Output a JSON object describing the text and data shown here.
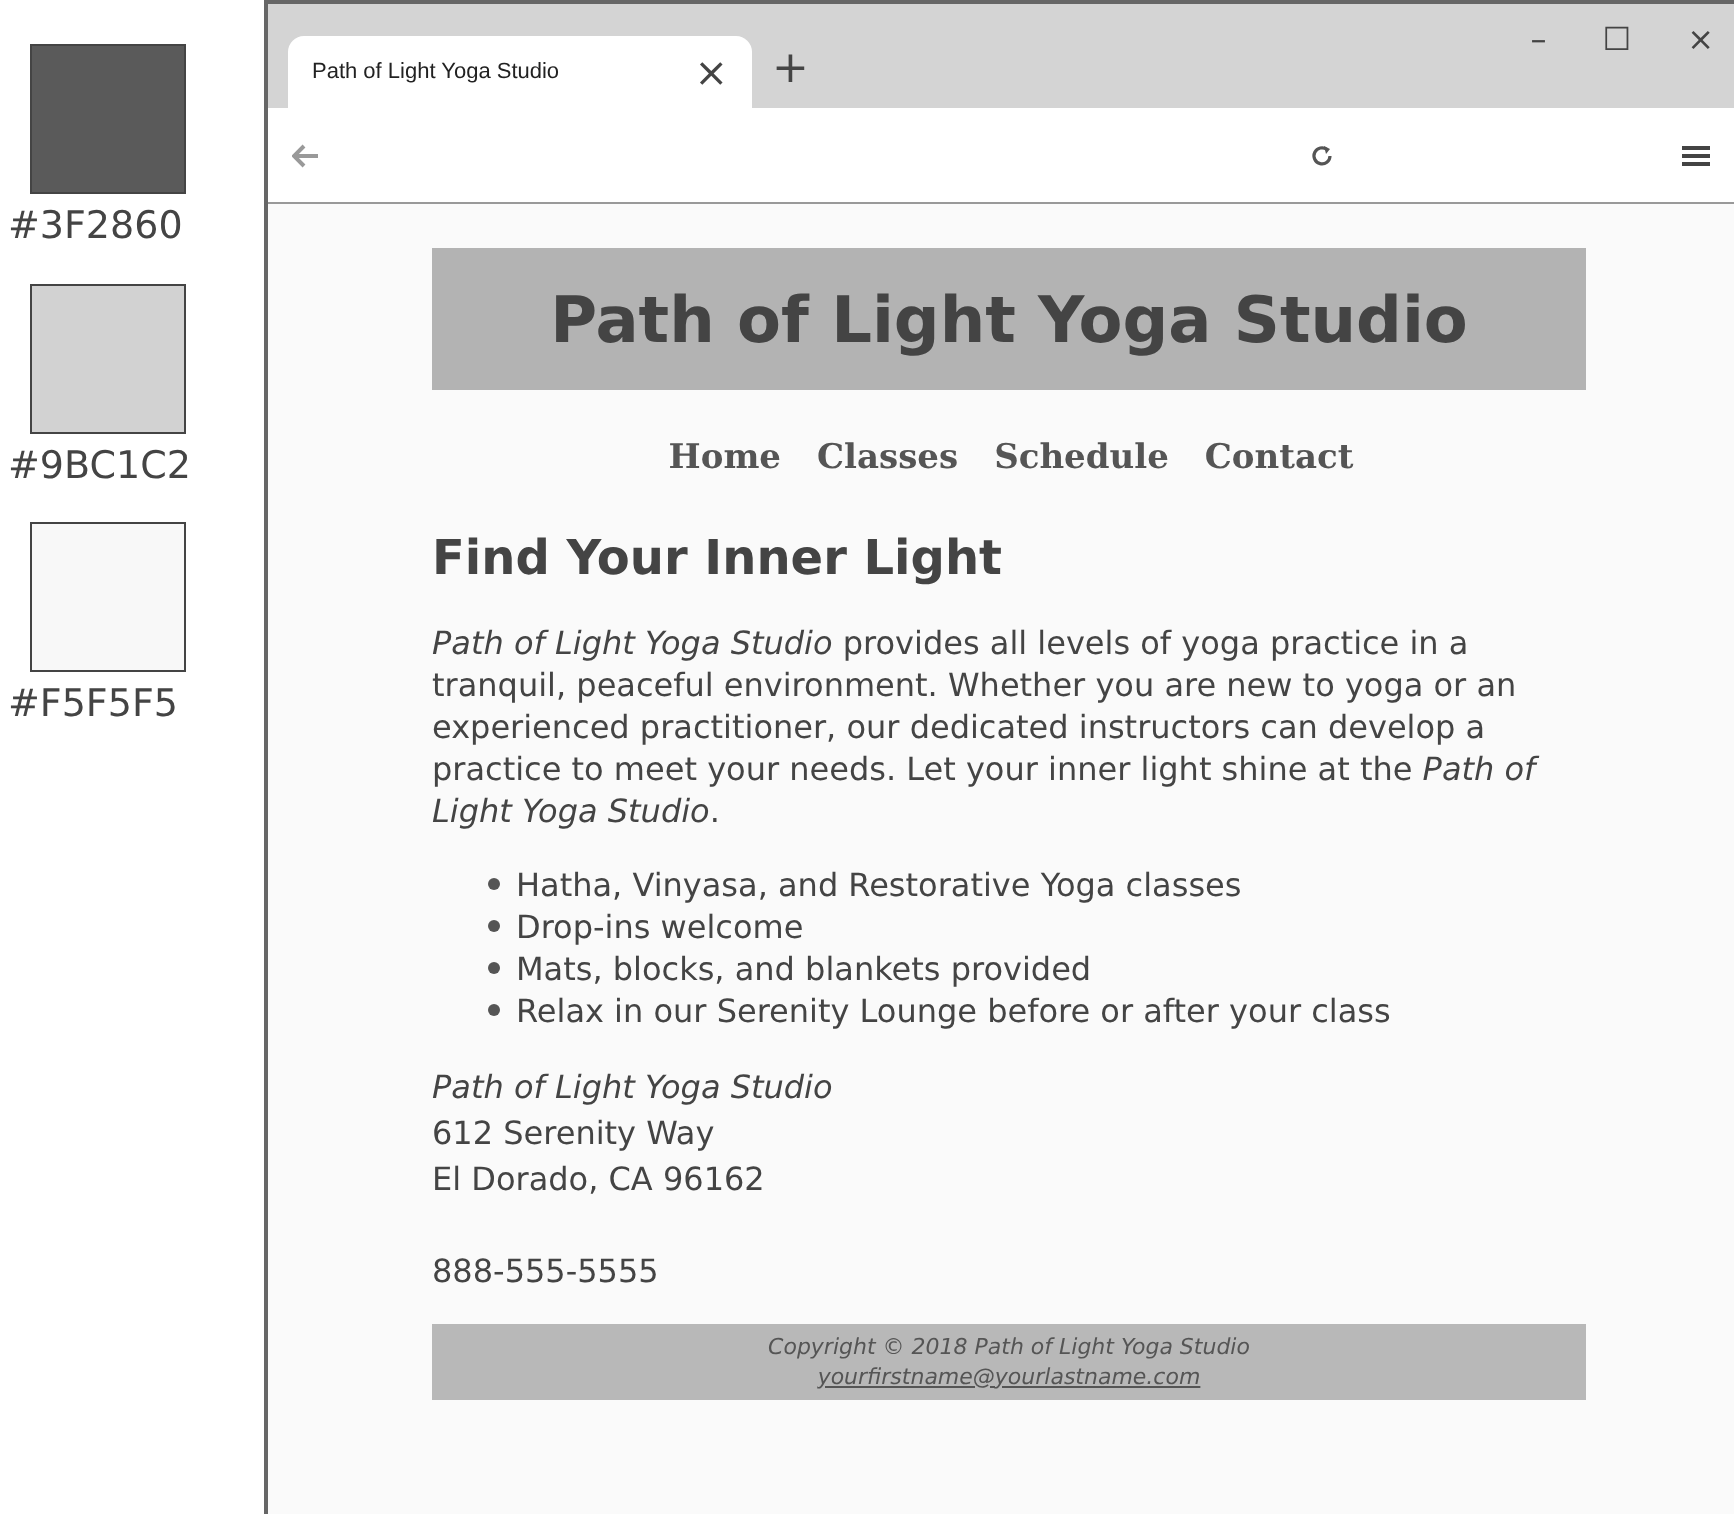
{
  "swatches": [
    {
      "label": "#3F2860",
      "color": "#5a5a5a"
    },
    {
      "label": "#9BC1C2",
      "color": "#d2d2d2"
    },
    {
      "label": "#F5F5F5",
      "color": "#f8f8f8"
    }
  ],
  "browser": {
    "tab": {
      "title": "Path of Light Yoga Studio",
      "close": "×",
      "new_tab": "+"
    },
    "window_controls": [
      "–",
      "☐",
      "×"
    ]
  },
  "page": {
    "header": "Path of Light Yoga Studio",
    "nav": [
      "Home",
      "Classes",
      "Schedule",
      "Contact"
    ],
    "heading": "Find Your Inner Light",
    "intro": "*Path of Light Yoga Studio* provides all levels of yoga practice in a tranquil, peaceful environment. Whether you are new to yoga or an experienced practitioner, our dedicated instructors can develop a practice to meet your needs. Let your inner light shine at the *Path of Light Yoga Studio*.",
    "features": [
      "Hatha, Vinyasa, and Restorative Yoga classes",
      "Drop-ins welcome",
      "Mats, blocks, and blankets provided",
      "Relax in our Serenity Lounge before or after your class"
    ],
    "address": {
      "name": "Path of Light Yoga Studio",
      "street": "612 Serenity Way",
      "city": "El Dorado, CA 96162"
    },
    "phone": "888-555-5555",
    "footer": {
      "copyright": "Copyright © 2018 Path of Light Yoga Studio",
      "email": "yourfirstname@yourlastname.com"
    }
  }
}
